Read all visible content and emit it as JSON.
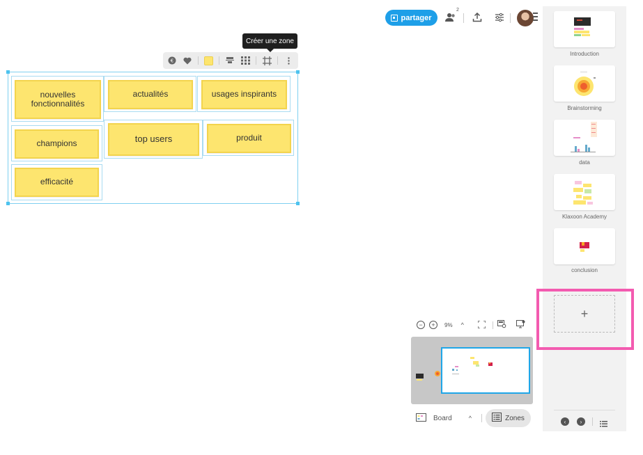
{
  "header": {
    "share_label": "partager",
    "users_count": "2",
    "icons": [
      "qr-icon",
      "users-icon",
      "upload-icon",
      "settings-sliders-icon",
      "avatar",
      "menu-icon"
    ]
  },
  "tooltip": {
    "text": "Créer une zone"
  },
  "selection_toolbar": {
    "icons": [
      "reaction-icon",
      "heart-icon",
      "color-swatch-icon",
      "align-icon",
      "grid-icon",
      "frame-icon",
      "more-icon"
    ],
    "swatch_color": "#fde56f"
  },
  "board": {
    "notes": [
      {
        "text": "nouvelles fonctionnalités"
      },
      {
        "text": "actualités"
      },
      {
        "text": "usages inspirants"
      },
      {
        "text": "champions"
      },
      {
        "text": "top users"
      },
      {
        "text": "produit"
      },
      {
        "text": "efficacité"
      }
    ]
  },
  "sidebar": {
    "slides": [
      {
        "label": "Introduction"
      },
      {
        "label": "Brainstorming"
      },
      {
        "label": "data"
      },
      {
        "label": "Klaxoon Academy"
      },
      {
        "label": "conclusion"
      }
    ],
    "add_label": "+"
  },
  "zoom": {
    "level": "9%"
  },
  "footer": {
    "board_label": "Board",
    "zones_label": "Zones"
  },
  "colors": {
    "accent": "#1e9fe8",
    "note": "#fde56f",
    "highlight": "#f35bb0"
  }
}
